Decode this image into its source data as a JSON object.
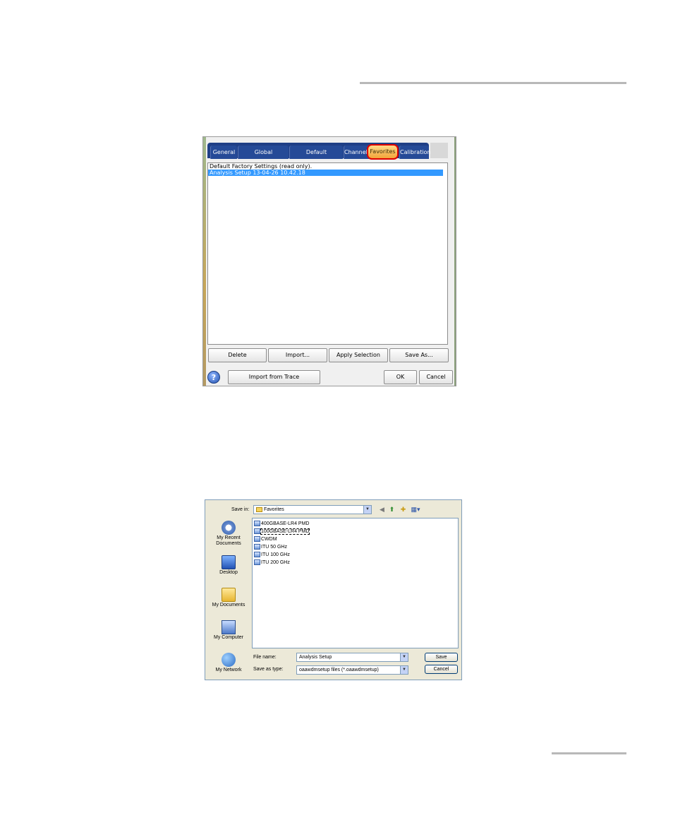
{
  "dialog1": {
    "tabs": [
      "General",
      "Global Thresholds",
      "Default Thresholds",
      "Channels",
      "Favorites",
      "Calibration"
    ],
    "active_tab": "Favorites",
    "list_items": [
      "Default Factory Settings (read only).",
      "Analysis Setup 13-04-26 10.42.18"
    ],
    "selected_index": 1,
    "buttons": {
      "delete": "Delete",
      "import": "Import...",
      "apply": "Apply Selection",
      "save_as": "Save As...",
      "import_trace": "Import from Trace",
      "ok": "OK",
      "cancel": "Cancel"
    },
    "help_glyph": "?"
  },
  "dialog2": {
    "save_in_label": "Save in:",
    "save_in_value": "Favorites",
    "places": [
      "My Recent Documents",
      "Desktop",
      "My Documents",
      "My Computer",
      "My Network"
    ],
    "files": [
      "400GBASE-LR4 PMD",
      "100GBASE-LR4 PMD",
      "CWDM",
      "ITU 50 GHz",
      "ITU 100 GHz",
      "ITU 200 GHz"
    ],
    "focused_file_index": 1,
    "file_name_label": "File name:",
    "file_name_value": "Analysis Setup",
    "save_type_label": "Save as type:",
    "save_type_value": "oaawdmsetup files (*.oaawdmsetup)",
    "save_button": "Save",
    "cancel_button": "Cancel"
  },
  "colors": {
    "tab_bar": "#1f3f86",
    "active_tab": "#f2a53a",
    "highlight_ring": "#e00000",
    "selection": "#3399ff"
  }
}
